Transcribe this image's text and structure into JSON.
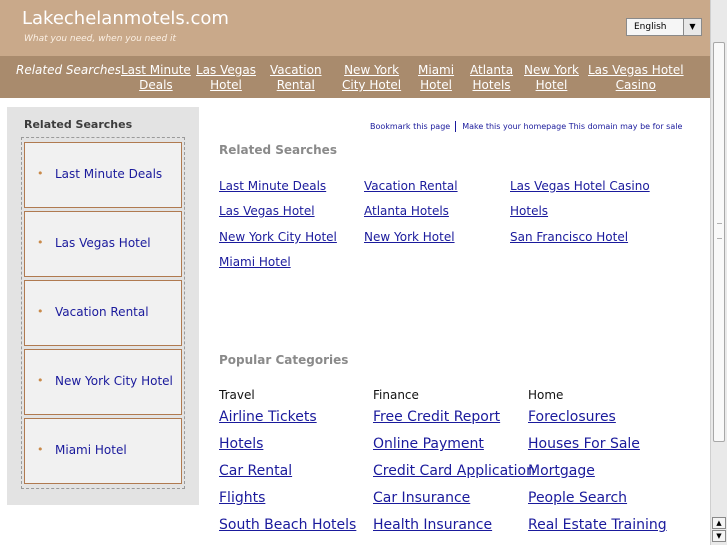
{
  "header": {
    "site_title": "Lakechelanmotels.com",
    "tagline": "What you need, when you need it",
    "language": "English",
    "language_arrow": "▼",
    "bg_color": "#c9a98a"
  },
  "nav": {
    "label": "Related Searches",
    "items": [
      {
        "line1": "Last Minute",
        "line2": "Deals"
      },
      {
        "line1": "Las Vegas",
        "line2": "Hotel"
      },
      {
        "line1": "Vacation",
        "line2": "Rental"
      },
      {
        "line1": "New York",
        "line2": "City Hotel"
      },
      {
        "line1": "Miami",
        "line2": "Hotel"
      },
      {
        "line1": "Atlanta",
        "line2": "Hotels"
      },
      {
        "line1": "New York",
        "line2": "Hotel"
      },
      {
        "line1": "Las Vegas Hotel",
        "line2": "Casino"
      }
    ],
    "bg_color": "#a98b6d"
  },
  "sidebar": {
    "title": "Related Searches",
    "bullet": "•",
    "items": [
      "Last Minute Deals",
      "Las Vegas Hotel",
      "Vacation Rental",
      "New York City Hotel",
      "Miami Hotel"
    ]
  },
  "bookmark": {
    "bookmark_label": "Bookmark this page",
    "homepage_label": "Make this your homepage",
    "sale_label": "This domain may be for sale"
  },
  "related": {
    "heading": "Related Searches",
    "links": [
      "Last Minute Deals",
      "Vacation Rental",
      "Las Vegas Hotel Casino",
      "Las Vegas Hotel",
      "Atlanta Hotels",
      "Hotels",
      "New York City Hotel",
      "New York Hotel",
      "San Francisco Hotel",
      "Miami Hotel"
    ]
  },
  "popular": {
    "heading": "Popular Categories",
    "columns": [
      {
        "title": "Travel",
        "links": [
          "Airline Tickets",
          "Hotels",
          "Car Rental",
          "Flights",
          "South Beach Hotels"
        ]
      },
      {
        "title": "Finance",
        "links": [
          "Free Credit Report",
          "Online Payment",
          "Credit Card Application",
          "Car Insurance",
          "Health Insurance"
        ]
      },
      {
        "title": "Home",
        "links": [
          "Foreclosures",
          "Houses For Sale",
          "Mortgage",
          "People Search",
          "Real Estate Training"
        ]
      }
    ]
  },
  "scrollbar": {
    "up_arrow": "▲",
    "down_arrow": "▼"
  },
  "colors": {
    "link": "#1a1a9c",
    "sidebar_border": "#b07a50"
  }
}
